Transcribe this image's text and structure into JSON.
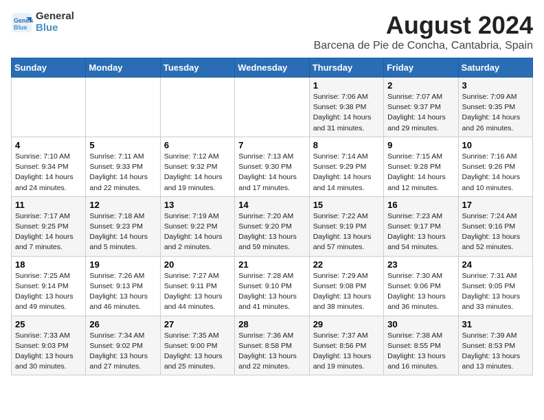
{
  "header": {
    "logo_line1": "General",
    "logo_line2": "Blue",
    "month_year": "August 2024",
    "location": "Barcena de Pie de Concha, Cantabria, Spain"
  },
  "weekdays": [
    "Sunday",
    "Monday",
    "Tuesday",
    "Wednesday",
    "Thursday",
    "Friday",
    "Saturday"
  ],
  "weeks": [
    [
      {
        "day": "",
        "content": ""
      },
      {
        "day": "",
        "content": ""
      },
      {
        "day": "",
        "content": ""
      },
      {
        "day": "",
        "content": ""
      },
      {
        "day": "1",
        "content": "Sunrise: 7:06 AM\nSunset: 9:38 PM\nDaylight: 14 hours\nand 31 minutes."
      },
      {
        "day": "2",
        "content": "Sunrise: 7:07 AM\nSunset: 9:37 PM\nDaylight: 14 hours\nand 29 minutes."
      },
      {
        "day": "3",
        "content": "Sunrise: 7:09 AM\nSunset: 9:35 PM\nDaylight: 14 hours\nand 26 minutes."
      }
    ],
    [
      {
        "day": "4",
        "content": "Sunrise: 7:10 AM\nSunset: 9:34 PM\nDaylight: 14 hours\nand 24 minutes."
      },
      {
        "day": "5",
        "content": "Sunrise: 7:11 AM\nSunset: 9:33 PM\nDaylight: 14 hours\nand 22 minutes."
      },
      {
        "day": "6",
        "content": "Sunrise: 7:12 AM\nSunset: 9:32 PM\nDaylight: 14 hours\nand 19 minutes."
      },
      {
        "day": "7",
        "content": "Sunrise: 7:13 AM\nSunset: 9:30 PM\nDaylight: 14 hours\nand 17 minutes."
      },
      {
        "day": "8",
        "content": "Sunrise: 7:14 AM\nSunset: 9:29 PM\nDaylight: 14 hours\nand 14 minutes."
      },
      {
        "day": "9",
        "content": "Sunrise: 7:15 AM\nSunset: 9:28 PM\nDaylight: 14 hours\nand 12 minutes."
      },
      {
        "day": "10",
        "content": "Sunrise: 7:16 AM\nSunset: 9:26 PM\nDaylight: 14 hours\nand 10 minutes."
      }
    ],
    [
      {
        "day": "11",
        "content": "Sunrise: 7:17 AM\nSunset: 9:25 PM\nDaylight: 14 hours\nand 7 minutes."
      },
      {
        "day": "12",
        "content": "Sunrise: 7:18 AM\nSunset: 9:23 PM\nDaylight: 14 hours\nand 5 minutes."
      },
      {
        "day": "13",
        "content": "Sunrise: 7:19 AM\nSunset: 9:22 PM\nDaylight: 14 hours\nand 2 minutes."
      },
      {
        "day": "14",
        "content": "Sunrise: 7:20 AM\nSunset: 9:20 PM\nDaylight: 13 hours\nand 59 minutes."
      },
      {
        "day": "15",
        "content": "Sunrise: 7:22 AM\nSunset: 9:19 PM\nDaylight: 13 hours\nand 57 minutes."
      },
      {
        "day": "16",
        "content": "Sunrise: 7:23 AM\nSunset: 9:17 PM\nDaylight: 13 hours\nand 54 minutes."
      },
      {
        "day": "17",
        "content": "Sunrise: 7:24 AM\nSunset: 9:16 PM\nDaylight: 13 hours\nand 52 minutes."
      }
    ],
    [
      {
        "day": "18",
        "content": "Sunrise: 7:25 AM\nSunset: 9:14 PM\nDaylight: 13 hours\nand 49 minutes."
      },
      {
        "day": "19",
        "content": "Sunrise: 7:26 AM\nSunset: 9:13 PM\nDaylight: 13 hours\nand 46 minutes."
      },
      {
        "day": "20",
        "content": "Sunrise: 7:27 AM\nSunset: 9:11 PM\nDaylight: 13 hours\nand 44 minutes."
      },
      {
        "day": "21",
        "content": "Sunrise: 7:28 AM\nSunset: 9:10 PM\nDaylight: 13 hours\nand 41 minutes."
      },
      {
        "day": "22",
        "content": "Sunrise: 7:29 AM\nSunset: 9:08 PM\nDaylight: 13 hours\nand 38 minutes."
      },
      {
        "day": "23",
        "content": "Sunrise: 7:30 AM\nSunset: 9:06 PM\nDaylight: 13 hours\nand 36 minutes."
      },
      {
        "day": "24",
        "content": "Sunrise: 7:31 AM\nSunset: 9:05 PM\nDaylight: 13 hours\nand 33 minutes."
      }
    ],
    [
      {
        "day": "25",
        "content": "Sunrise: 7:33 AM\nSunset: 9:03 PM\nDaylight: 13 hours\nand 30 minutes."
      },
      {
        "day": "26",
        "content": "Sunrise: 7:34 AM\nSunset: 9:02 PM\nDaylight: 13 hours\nand 27 minutes."
      },
      {
        "day": "27",
        "content": "Sunrise: 7:35 AM\nSunset: 9:00 PM\nDaylight: 13 hours\nand 25 minutes."
      },
      {
        "day": "28",
        "content": "Sunrise: 7:36 AM\nSunset: 8:58 PM\nDaylight: 13 hours\nand 22 minutes."
      },
      {
        "day": "29",
        "content": "Sunrise: 7:37 AM\nSunset: 8:56 PM\nDaylight: 13 hours\nand 19 minutes."
      },
      {
        "day": "30",
        "content": "Sunrise: 7:38 AM\nSunset: 8:55 PM\nDaylight: 13 hours\nand 16 minutes."
      },
      {
        "day": "31",
        "content": "Sunrise: 7:39 AM\nSunset: 8:53 PM\nDaylight: 13 hours\nand 13 minutes."
      }
    ]
  ]
}
